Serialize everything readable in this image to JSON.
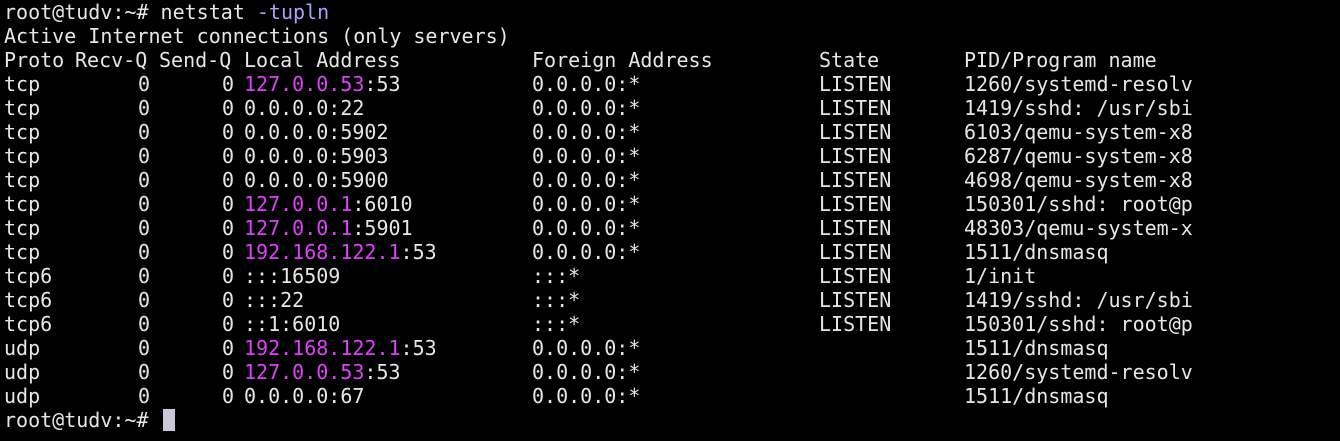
{
  "terminal": {
    "prompt": "root@tudv:~#",
    "command": "netstat",
    "flag": "-tupln",
    "title_line": "Active Internet connections (only servers)",
    "headers": {
      "proto": "Proto",
      "recv": "Recv-Q",
      "send": "Send-Q",
      "local": "Local Address",
      "foreign": "Foreign Address",
      "state": "State",
      "pid": "PID/Program name"
    },
    "rows": [
      {
        "proto": "tcp",
        "recv": "0",
        "send": "0",
        "local_ip": "127.0.0.53",
        "local_ip_hl": true,
        "local_port": ":53",
        "foreign": "0.0.0.0:*",
        "state": "LISTEN",
        "pid": "1260/systemd-resolv"
      },
      {
        "proto": "tcp",
        "recv": "0",
        "send": "0",
        "local_ip": "0.0.0.0",
        "local_ip_hl": false,
        "local_port": ":22",
        "foreign": "0.0.0.0:*",
        "state": "LISTEN",
        "pid": "1419/sshd: /usr/sbi"
      },
      {
        "proto": "tcp",
        "recv": "0",
        "send": "0",
        "local_ip": "0.0.0.0",
        "local_ip_hl": false,
        "local_port": ":5902",
        "foreign": "0.0.0.0:*",
        "state": "LISTEN",
        "pid": "6103/qemu-system-x8"
      },
      {
        "proto": "tcp",
        "recv": "0",
        "send": "0",
        "local_ip": "0.0.0.0",
        "local_ip_hl": false,
        "local_port": ":5903",
        "foreign": "0.0.0.0:*",
        "state": "LISTEN",
        "pid": "6287/qemu-system-x8"
      },
      {
        "proto": "tcp",
        "recv": "0",
        "send": "0",
        "local_ip": "0.0.0.0",
        "local_ip_hl": false,
        "local_port": ":5900",
        "foreign": "0.0.0.0:*",
        "state": "LISTEN",
        "pid": "4698/qemu-system-x8"
      },
      {
        "proto": "tcp",
        "recv": "0",
        "send": "0",
        "local_ip": "127.0.0.1",
        "local_ip_hl": true,
        "local_port": ":6010",
        "foreign": "0.0.0.0:*",
        "state": "LISTEN",
        "pid": "150301/sshd: root@p"
      },
      {
        "proto": "tcp",
        "recv": "0",
        "send": "0",
        "local_ip": "127.0.0.1",
        "local_ip_hl": true,
        "local_port": ":5901",
        "foreign": "0.0.0.0:*",
        "state": "LISTEN",
        "pid": "48303/qemu-system-x"
      },
      {
        "proto": "tcp",
        "recv": "0",
        "send": "0",
        "local_ip": "192.168.122.1",
        "local_ip_hl": true,
        "local_port": ":53",
        "foreign": "0.0.0.0:*",
        "state": "LISTEN",
        "pid": "1511/dnsmasq"
      },
      {
        "proto": "tcp6",
        "recv": "0",
        "send": "0",
        "local_ip": ":::16509",
        "local_ip_hl": false,
        "local_port": "",
        "foreign": ":::*",
        "state": "LISTEN",
        "pid": "1/init"
      },
      {
        "proto": "tcp6",
        "recv": "0",
        "send": "0",
        "local_ip": ":::22",
        "local_ip_hl": false,
        "local_port": "",
        "foreign": ":::*",
        "state": "LISTEN",
        "pid": "1419/sshd: /usr/sbi"
      },
      {
        "proto": "tcp6",
        "recv": "0",
        "send": "0",
        "local_ip": "::1:6010",
        "local_ip_hl": false,
        "local_port": "",
        "foreign": ":::*",
        "state": "LISTEN",
        "pid": "150301/sshd: root@p"
      },
      {
        "proto": "udp",
        "recv": "0",
        "send": "0",
        "local_ip": "192.168.122.1",
        "local_ip_hl": true,
        "local_port": ":53",
        "foreign": "0.0.0.0:*",
        "state": "",
        "pid": "1511/dnsmasq"
      },
      {
        "proto": "udp",
        "recv": "0",
        "send": "0",
        "local_ip": "127.0.0.53",
        "local_ip_hl": true,
        "local_port": ":53",
        "foreign": "0.0.0.0:*",
        "state": "",
        "pid": "1260/systemd-resolv"
      },
      {
        "proto": "udp",
        "recv": "0",
        "send": "0",
        "local_ip": "0.0.0.0",
        "local_ip_hl": false,
        "local_port": ":67",
        "foreign": "0.0.0.0:*",
        "state": "",
        "pid": "1511/dnsmasq"
      }
    ],
    "colors": {
      "background": "#000000",
      "text": "#e6e6e6",
      "flag": "#b09cff",
      "ip_highlight": "#e040fb",
      "cursor": "#c8c8d8"
    }
  }
}
